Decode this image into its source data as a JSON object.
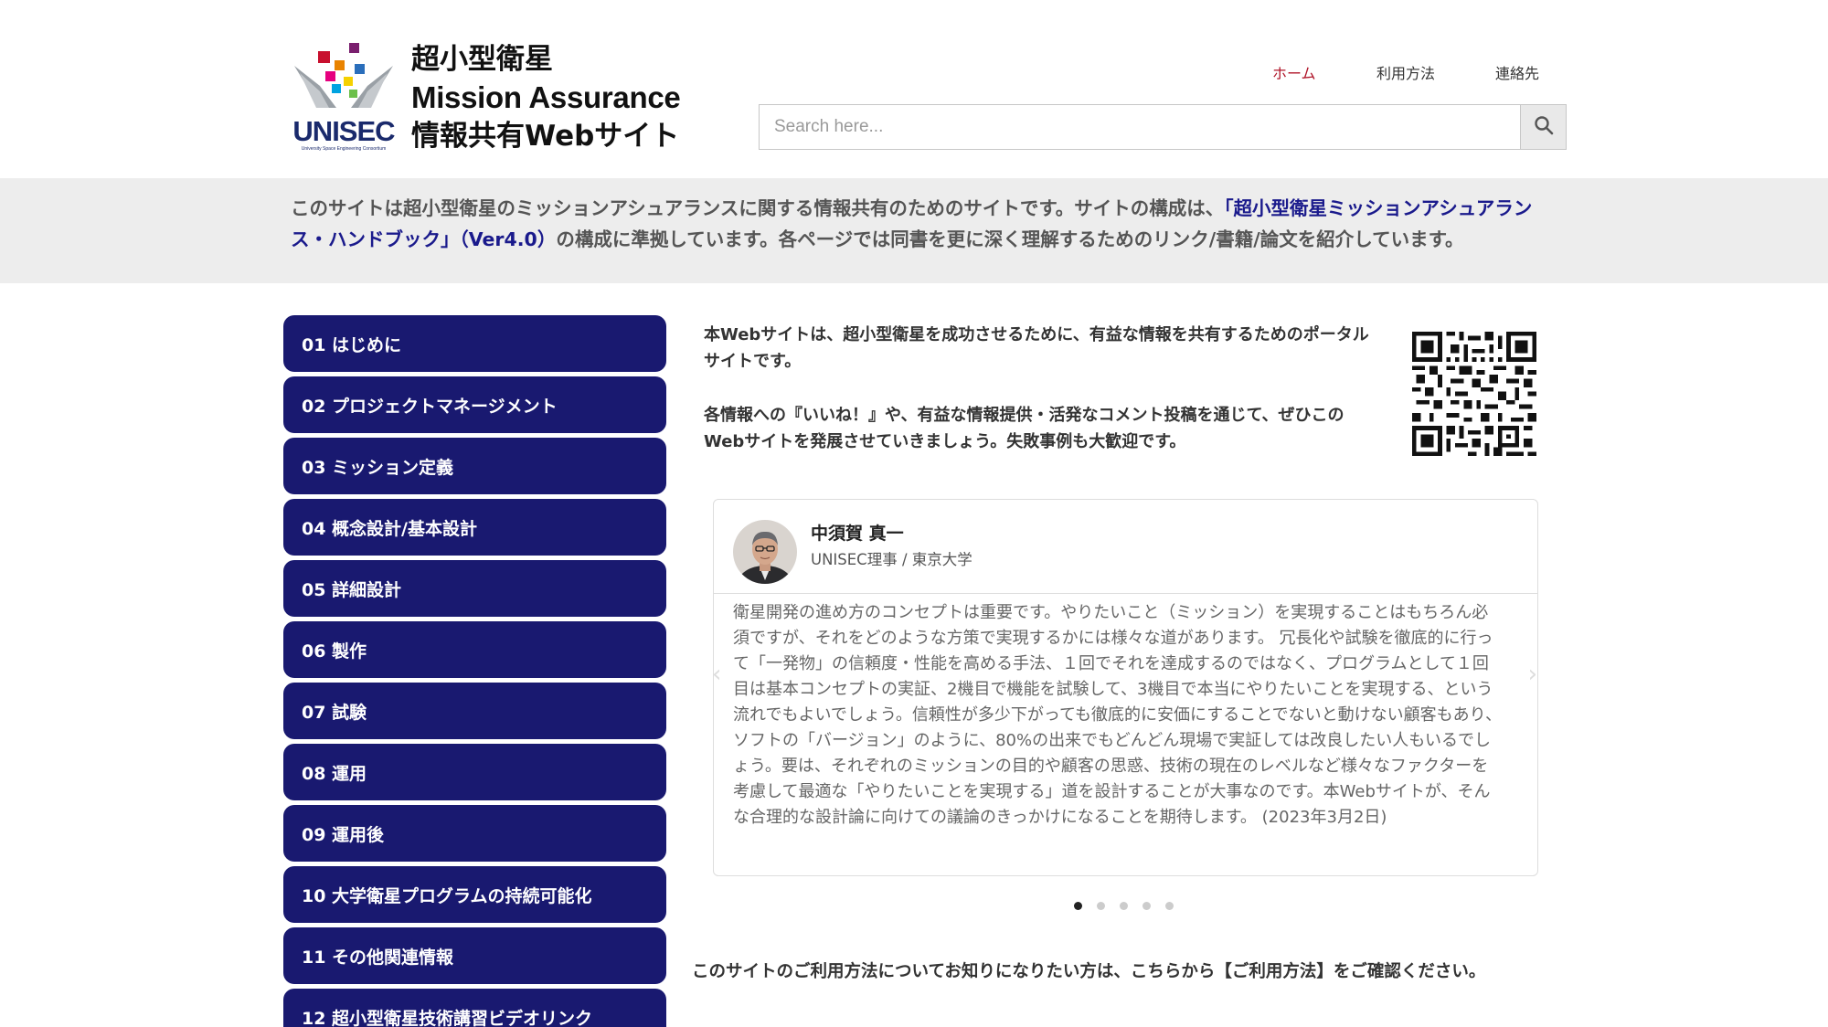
{
  "site": {
    "logo_text": "UNISEC",
    "logo_subtext": "University Space Engineering Consortium",
    "title_line1": "超小型衛星",
    "title_line2": "Mission Assurance",
    "title_line3": "情報共有Webサイト"
  },
  "nav": {
    "home": "ホーム",
    "usage": "利用方法",
    "contact": "連絡先"
  },
  "search": {
    "placeholder": "Search here...",
    "icon": "search-icon"
  },
  "intro_band": {
    "text_before": "このサイトは超小型衛星のミッションアシュアランスに関する情報共有のためのサイトです。サイトの構成は、",
    "highlight": "「超小型衛星ミッションアシュアランス・ハンドブック」（Ver4.0）",
    "text_after": "の構成に準拠しています。各ページでは同書を更に深く理解するためのリンク/書籍/論文を紹介しています。"
  },
  "sidebar": {
    "items": [
      {
        "label": "01 はじめに"
      },
      {
        "label": "02 プロジェクトマネージメント"
      },
      {
        "label": "03 ミッション定義"
      },
      {
        "label": "04 概念設計/基本設計"
      },
      {
        "label": "05 詳細設計"
      },
      {
        "label": "06 製作"
      },
      {
        "label": "07 試験"
      },
      {
        "label": "08 運用"
      },
      {
        "label": "09 運用後"
      },
      {
        "label": "10 大学衛星プログラムの持続可能化"
      },
      {
        "label": "11 その他関連情報"
      },
      {
        "label": "12 超小型衛星技術講習ビデオリンク"
      }
    ]
  },
  "main": {
    "intro_p1": "本Webサイトは、超小型衛星を成功させるために、有益な情報を共有するためのポータルサイトです。",
    "intro_p2": "各情報への『いいね！』や、有益な情報提供・活発なコメント投稿を通じて、ぜひこのWebサイトを発展させていきましょう。失敗事例も大歓迎です。",
    "testimonial": {
      "name": "中須賀 真一",
      "role": "UNISEC理事 / 東京大学",
      "text": "衛星開発の進め方のコンセプトは重要です。やりたいこと（ミッション）を実現することはもちろん必須ですが、それをどのような方策で実現するかには様々な道があります。 冗長化や試験を徹底的に行って「一発物」の信頼度・性能を高める手法、１回でそれを達成するのではなく、プログラムとして１回目は基本コンセプトの実証、2機目で機能を試験して、3機目で本当にやりたいことを実現する、という流れでもよいでしょう。信頼性が多少下がっても徹底的に安価にすることでないと動けない顧客もあり、ソフトの「バージョン」のように、80%の出来でもどんどん現場で実証しては改良したい人もいるでしょう。要は、それぞれのミッションの目的や顧客の思惑、技術の現在のレベルなど様々なファクターを考慮して最適な「やりたいことを実現する」道を設計することが大事なのです。本Webサイトが、そんな合理的な設計論に向けての議論のきっかけになることを期待します。 (2023年3月2日)",
      "prev_icon": "chevron-left-icon",
      "next_icon": "chevron-right-icon"
    },
    "carousel": {
      "slide_count": 5,
      "active_index": 0
    },
    "footnote": "このサイトのご利用方法についてお知りになりたい方は、こちらから【ご利用方法】をご確認ください。"
  },
  "colors": {
    "nav_active": "#b0162a",
    "sidebar_bg": "#191970",
    "highlight_text": "#1a1a8c",
    "band_bg": "#ededed"
  }
}
